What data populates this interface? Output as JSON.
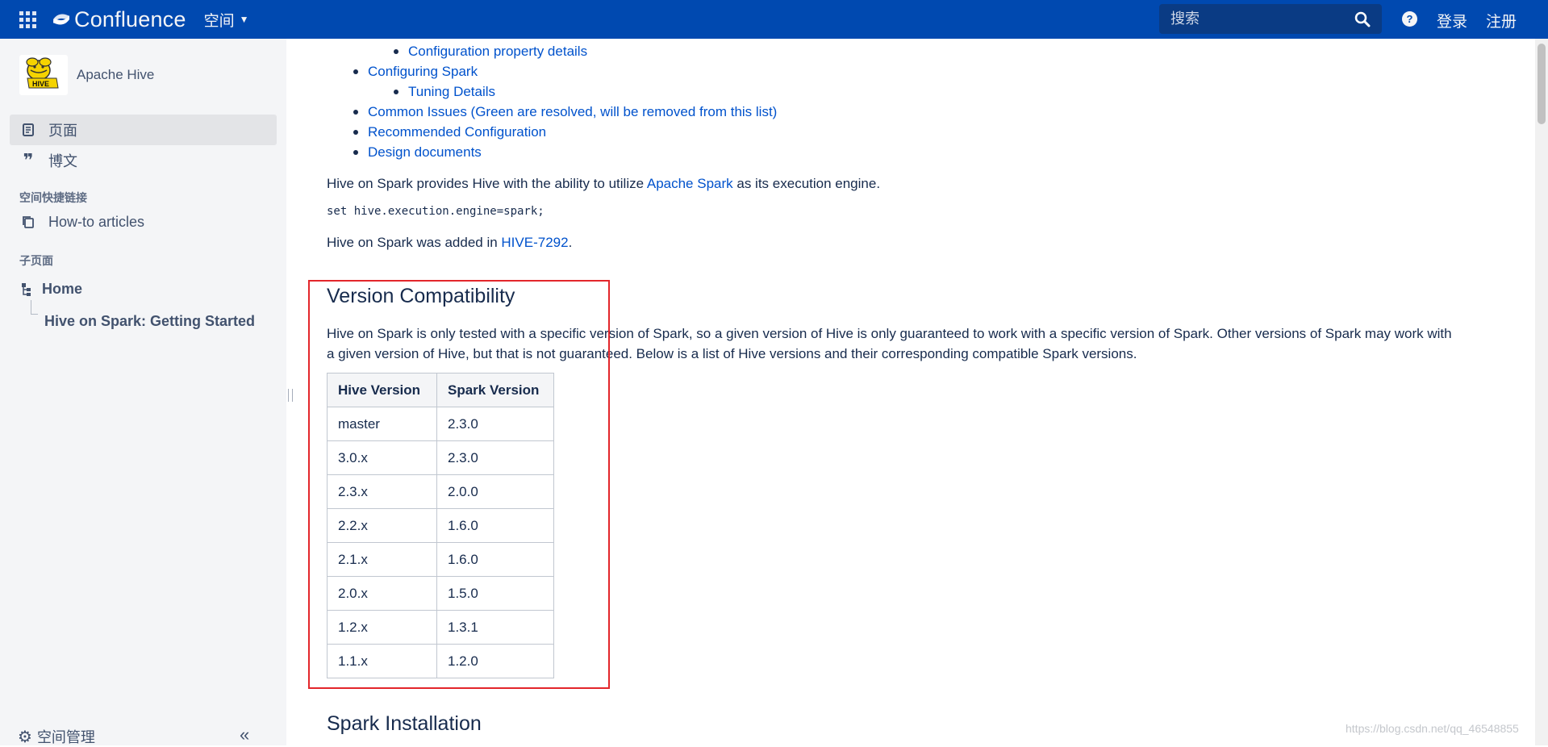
{
  "topbar": {
    "product_name": "Confluence",
    "spaces_label": "空间",
    "search_placeholder": "搜索",
    "help_symbol": "?",
    "login_label": "登录",
    "signup_label": "注册",
    "background_color": "#0049b0"
  },
  "sidebar": {
    "space_name": "Apache Hive",
    "nav": [
      {
        "label": "页面",
        "icon": "page-icon",
        "active": true
      },
      {
        "label": "博文",
        "icon": "quote-icon",
        "active": false
      }
    ],
    "shortcuts_heading": "空间快捷链接",
    "shortcuts": [
      {
        "label": "How-to articles",
        "icon": "copy-icon"
      }
    ],
    "children_heading": "子页面",
    "tree": {
      "root": {
        "label": "Home",
        "icon": "hierarchy-icon"
      },
      "child": {
        "label": "Hive on Spark: Getting Started"
      }
    },
    "space_tools_label": "空间管理",
    "collapse_symbol": "«"
  },
  "main": {
    "toc": [
      {
        "label": "Configuration property details",
        "level": 2
      },
      {
        "label": "Configuring Spark",
        "level": 1
      },
      {
        "label": "Tuning Details",
        "level": 2
      },
      {
        "label": "Common Issues (Green are resolved, will be removed from this list)",
        "level": 1
      },
      {
        "label": "Recommended Configuration",
        "level": 1
      },
      {
        "label": "Design documents",
        "level": 1
      }
    ],
    "intro": {
      "before_link": "Hive on Spark provides Hive with the ability to utilize ",
      "link": "Apache Spark",
      "after_link": " as its execution engine."
    },
    "code": "set hive.execution.engine=spark;",
    "added": {
      "before_link": "Hive on Spark was added in ",
      "link": "HIVE-7292",
      "after_link": "."
    },
    "version_heading": "Version Compatibility",
    "version_paragraph_line1": "Hive on Spark is only tested with a specific version of Spark, so a given version of Hive is only guaranteed to work with a specific version of Spark. Other versions of Spark may work with",
    "version_paragraph_line2": "a given version of Hive, but that is not guaranteed. Below is a list of Hive versions and their corresponding compatible Spark versions.",
    "table": {
      "headers": [
        "Hive Version",
        "Spark Version"
      ],
      "rows": [
        [
          "master",
          "2.3.0"
        ],
        [
          "3.0.x",
          "2.3.0"
        ],
        [
          "2.3.x",
          "2.0.0"
        ],
        [
          "2.2.x",
          "1.6.0"
        ],
        [
          "2.1.x",
          "1.6.0"
        ],
        [
          "2.0.x",
          "1.5.0"
        ],
        [
          "1.2.x",
          "1.3.1"
        ],
        [
          "1.1.x",
          "1.2.0"
        ]
      ]
    },
    "next_heading": "Spark Installation",
    "highlight_color": "#e3262b",
    "link_color": "#0052cc"
  },
  "watermark": "https://blog.csdn.net/qq_46548855"
}
